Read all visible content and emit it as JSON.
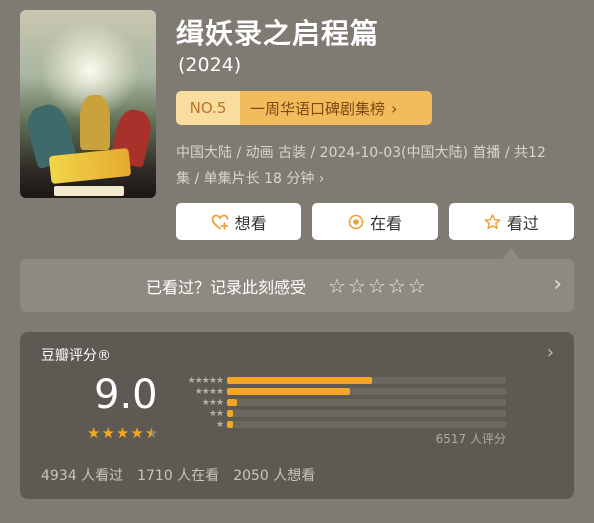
{
  "title": "缉妖录之启程篇",
  "year": "(2024)",
  "rank": {
    "number": "NO.5",
    "label": "一周华语口碑剧集榜",
    "chevron": "›"
  },
  "meta": {
    "line1": "中国大陆 / 动画 古装 / 2024-10-03(中国大陆) 首播 / 共12",
    "line2": "集 / 单集片长 18 分钟 ›"
  },
  "actions": [
    {
      "label": "想看",
      "icon": "heart-plus-icon"
    },
    {
      "label": "在看",
      "icon": "target-circle-icon"
    },
    {
      "label": "看过",
      "icon": "star-outline-icon"
    }
  ],
  "record": {
    "text": "已看过？记录此刻感受",
    "stars": [
      "☆",
      "☆",
      "☆",
      "☆",
      "☆"
    ],
    "chevron": "›"
  },
  "rating": {
    "title": "豆瓣评分®",
    "chevron": "›",
    "score": "9.0",
    "stars_value": 4.5,
    "distribution": [
      {
        "stars": "★★★★★",
        "fraction": 0.52
      },
      {
        "stars": "★★★★",
        "fraction": 0.44
      },
      {
        "stars": "★★★",
        "fraction": 0.035
      },
      {
        "stars": "★★",
        "fraction": 0.02
      },
      {
        "stars": "★",
        "fraction": 0.02
      }
    ],
    "count": "6517 人评分",
    "stats": [
      "4934 人看过",
      "1710 人在看",
      "2050 人想看"
    ]
  },
  "colors": {
    "accent": "#f5a623",
    "rank_bg": "#f3bb5c",
    "rank_no_bg": "#f9dd9e"
  }
}
